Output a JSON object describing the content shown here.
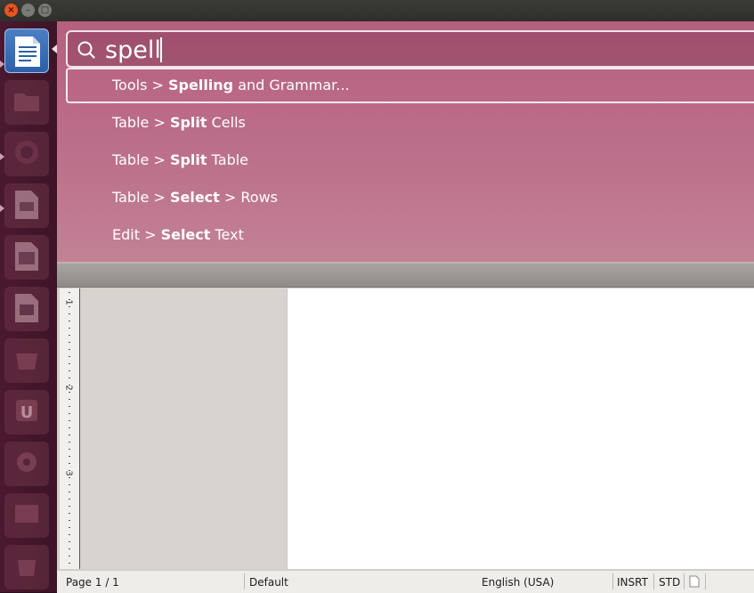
{
  "window": {
    "close_glyph": "×",
    "min_glyph": "–",
    "max_glyph": "□"
  },
  "launcher": {
    "items": [
      {
        "name": "libreoffice-writer-icon",
        "active": true
      },
      {
        "name": "files-folder-icon"
      },
      {
        "name": "firefox-icon"
      },
      {
        "name": "libreoffice-impress-icon"
      },
      {
        "name": "libreoffice-calc-icon"
      },
      {
        "name": "libreoffice-draw-icon"
      },
      {
        "name": "software-center-icon"
      },
      {
        "name": "ubuntu-one-icon"
      },
      {
        "name": "system-settings-icon"
      },
      {
        "name": "workspace-switcher-icon"
      },
      {
        "name": "trash-icon"
      }
    ]
  },
  "hud": {
    "query": "spell",
    "results": [
      {
        "menu": "Tools",
        "sep": " > ",
        "match": "Spelling",
        "rest": " and Grammar...",
        "selected": true
      },
      {
        "menu": "Table",
        "sep": " > ",
        "match": "Split",
        "rest": " Cells"
      },
      {
        "menu": "Table",
        "sep": " > ",
        "match": "Split",
        "rest": " Table"
      },
      {
        "menu": "Table",
        "sep": " > ",
        "match": "Select",
        "rest": " > Rows"
      },
      {
        "menu": "Edit",
        "sep": " > ",
        "match": "Select",
        "rest": " Text"
      }
    ]
  },
  "ruler": {
    "labels": [
      "1",
      "2",
      "3"
    ]
  },
  "statusbar": {
    "page": "Page 1 / 1",
    "style": "Default",
    "language": "English (USA)",
    "insert_mode": "INSRT",
    "selection_mode": "STD"
  },
  "colors": {
    "hud_tint": "#b04870",
    "launcher_bg": "#4a1930",
    "active_icon": "#2d5fa8"
  }
}
